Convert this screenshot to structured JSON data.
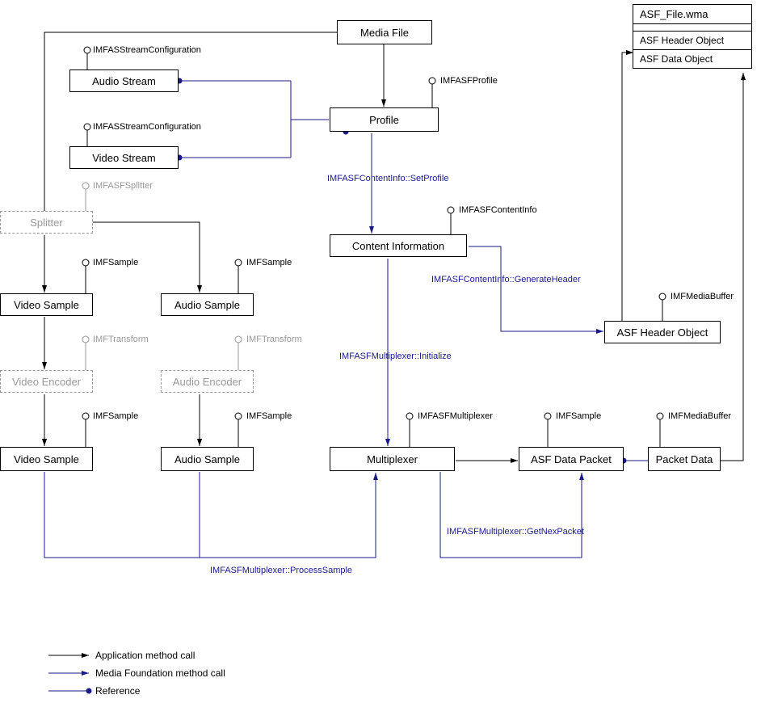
{
  "boxes": {
    "media_file": "Media File",
    "audio_stream": "Audio Stream",
    "video_stream": "Video Stream",
    "profile": "Profile",
    "content_info": "Content Information",
    "splitter": "Splitter",
    "video_sample_1": "Video Sample",
    "audio_sample_1": "Audio Sample",
    "video_encoder": "Video Encoder",
    "audio_encoder": "Audio Encoder",
    "video_sample_2": "Video Sample",
    "audio_sample_2": "Audio Sample",
    "multiplexer": "Multiplexer",
    "asf_data_packet": "ASF Data Packet",
    "packet_data": "Packet Data",
    "asf_header_object": "ASF Header Object"
  },
  "interfaces": {
    "imfas_stream_config_1": "IMFASStreamConfiguration",
    "imfas_stream_config_2": "IMFASStreamConfiguration",
    "imfasf_profile": "IMFASFProfile",
    "imfasf_splitter": "IMFASFSplitter",
    "imfasf_content_info": "IMFASFContentInfo",
    "imf_sample_vs1": "IMFSample",
    "imf_sample_as1": "IMFSample",
    "imf_transform_ve": "IMFTransform",
    "imf_transform_ae": "IMFTransform",
    "imf_sample_vs2": "IMFSample",
    "imf_sample_as2": "IMFSample",
    "imfasf_multiplexer": "IMFASFMultiplexer",
    "imf_sample_dp": "IMFSample",
    "imf_media_buffer_pd": "IMFMediaBuffer",
    "imf_media_buffer_ho": "IMFMediaBuffer"
  },
  "methods": {
    "set_profile": "IMFASFContentInfo::SetProfile",
    "generate_header": "IMFASFContentInfo::GenerateHeader",
    "mux_initialize": "IMFASFMultiplexer::Initialize",
    "processed_sample": "IMFASFMultiplexer::ProcessSample",
    "get_next_packet": "IMFASFMultiplexer::GetNexPacket"
  },
  "file": {
    "title": "ASF_File.wma",
    "rows": [
      "ASF Header Object",
      "ASF Data Object"
    ]
  },
  "legend": {
    "app_call": "Application method call",
    "mf_call": "Media Foundation method call",
    "reference": "Reference"
  }
}
